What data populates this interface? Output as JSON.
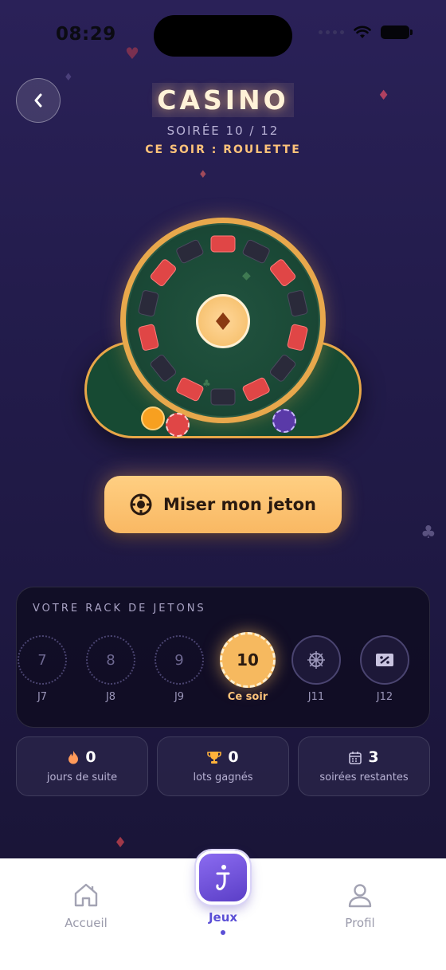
{
  "status_bar": {
    "time": "08:29"
  },
  "header": {
    "title": "CASINO",
    "subtitle": "SOIRÉE 10 / 12",
    "tonight": "CE SOIR : ROULETTE"
  },
  "bet_button": {
    "label": "Miser mon jeton"
  },
  "rack": {
    "title": "VOTRE RACK DE JETONS",
    "days": [
      {
        "number": "7",
        "label": "J7",
        "state": "past"
      },
      {
        "number": "8",
        "label": "J8",
        "state": "past"
      },
      {
        "number": "9",
        "label": "J9",
        "state": "past"
      },
      {
        "number": "10",
        "label": "Ce soir",
        "state": "today"
      },
      {
        "number": "",
        "label": "J11",
        "state": "upcoming",
        "icon": "wheel-icon"
      },
      {
        "number": "",
        "label": "J12",
        "state": "upcoming",
        "icon": "ticket-icon"
      }
    ]
  },
  "stats": [
    {
      "value": "0",
      "caption": "jours de suite",
      "icon": "flame-icon"
    },
    {
      "value": "0",
      "caption": "lots gagnés",
      "icon": "trophy-icon"
    },
    {
      "value": "3",
      "caption": "soirées restantes",
      "icon": "calendar-icon"
    }
  ],
  "nav": {
    "home": "Accueil",
    "games": "Jeux",
    "profile": "Profil"
  },
  "colors": {
    "accent_gold": "#f9b863",
    "table_green": "#174a33",
    "red_slot": "#e04646",
    "black_slot": "#2a2a3a",
    "nav_active": "#5b4fd6"
  }
}
